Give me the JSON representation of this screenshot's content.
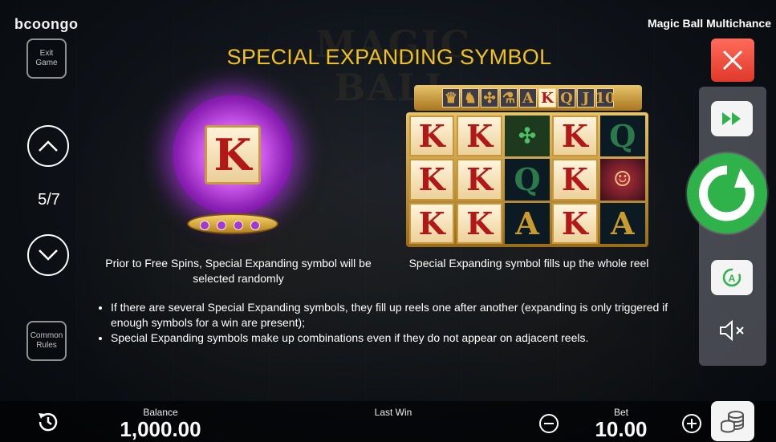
{
  "header": {
    "logo": "bcoongo",
    "game_title": "Magic Ball Multichance",
    "bg_title": "MAGIC BALL"
  },
  "left": {
    "exit_label": "Exit Game",
    "page_indicator": "5/7",
    "common_rules_label": "Common Rules"
  },
  "page": {
    "title": "SPECIAL EXPANDING SYMBOL",
    "orb_symbol": "K",
    "caption_left": "Prior to Free Spins, Special Expanding symbol will be selected randomly",
    "caption_right": "Special Expanding symbol fills up the whole reel",
    "paytable_symbols": [
      "lady",
      "knight",
      "celtic",
      "potion",
      "A",
      "K",
      "Q",
      "J",
      "10"
    ],
    "reel_grid": [
      [
        "K",
        "K",
        "celtic",
        "K",
        "Q"
      ],
      [
        "K",
        "K",
        "Q",
        "K",
        "girl"
      ],
      [
        "K",
        "K",
        "A",
        "K",
        "A"
      ]
    ],
    "rules": [
      "If there are several Special Expanding symbols, they fill up reels one after another (expanding is only triggered if enough symbols for a win are present);",
      "Special Expanding symbols make up combinations even if they do not appear on adjacent reels."
    ]
  },
  "bottom": {
    "balance_label": "Balance",
    "balance_value": "1,000.00",
    "last_win_label": "Last Win",
    "last_win_value": "",
    "bet_label": "Bet",
    "bet_value": "10.00"
  },
  "colors": {
    "title": "#f2c21a",
    "spin_button": "#2fb24a",
    "close_button": "#e0392a",
    "symbol_red": "#b31818"
  }
}
